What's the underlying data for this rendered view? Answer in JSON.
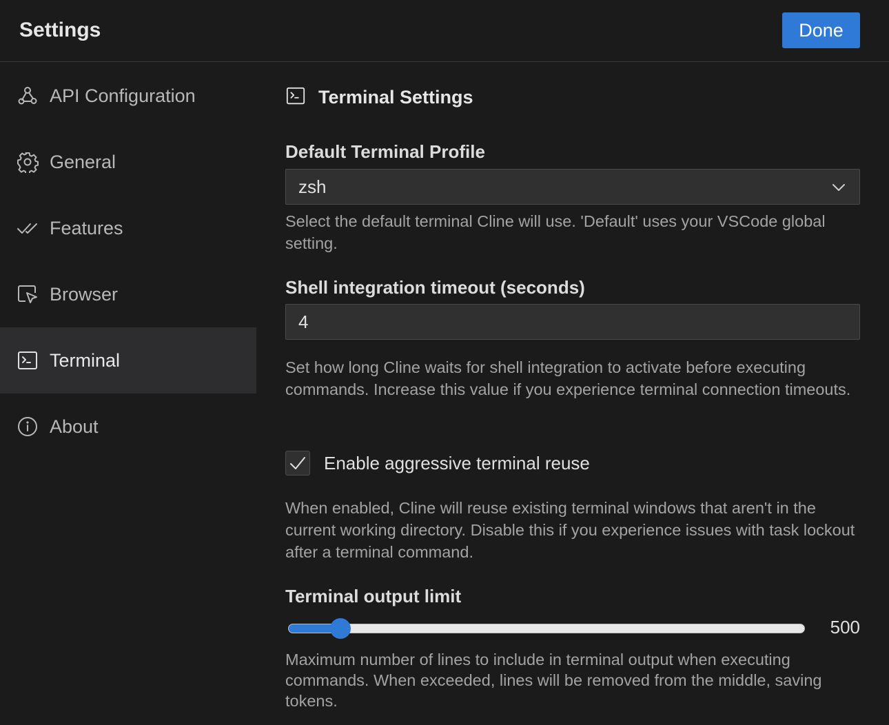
{
  "header": {
    "title": "Settings",
    "done_label": "Done"
  },
  "sidebar": {
    "items": [
      {
        "label": "API Configuration",
        "icon": "webhook-icon"
      },
      {
        "label": "General",
        "icon": "gear-icon"
      },
      {
        "label": "Features",
        "icon": "check-all-icon"
      },
      {
        "label": "Browser",
        "icon": "browser-cursor-icon"
      },
      {
        "label": "Terminal",
        "icon": "terminal-icon",
        "active": true
      },
      {
        "label": "About",
        "icon": "info-icon"
      }
    ]
  },
  "main": {
    "section_title": "Terminal Settings",
    "section_icon": "terminal-icon",
    "terminal_profile": {
      "label": "Default Terminal Profile",
      "value": "zsh",
      "description": "Select the default terminal Cline will use. 'Default' uses your VSCode global setting."
    },
    "shell_timeout": {
      "label": "Shell integration timeout (seconds)",
      "value": "4",
      "description": "Set how long Cline waits for shell integration to activate before executing commands. Increase this value if you experience terminal connection timeouts."
    },
    "aggressive_reuse": {
      "label": "Enable aggressive terminal reuse",
      "checked": true,
      "description": "When enabled, Cline will reuse existing terminal windows that aren't in the current working directory. Disable this if you experience issues with task lockout after a terminal command."
    },
    "output_limit": {
      "label": "Terminal output limit",
      "value": "500",
      "fraction": 0.1,
      "description": "Maximum number of lines to include in terminal output when executing commands. When exceeded, lines will be removed from the middle, saving tokens."
    }
  },
  "colors": {
    "accent": "#2f7ad6",
    "background": "#1b1b1c",
    "active_item": "#2d2d2f"
  }
}
